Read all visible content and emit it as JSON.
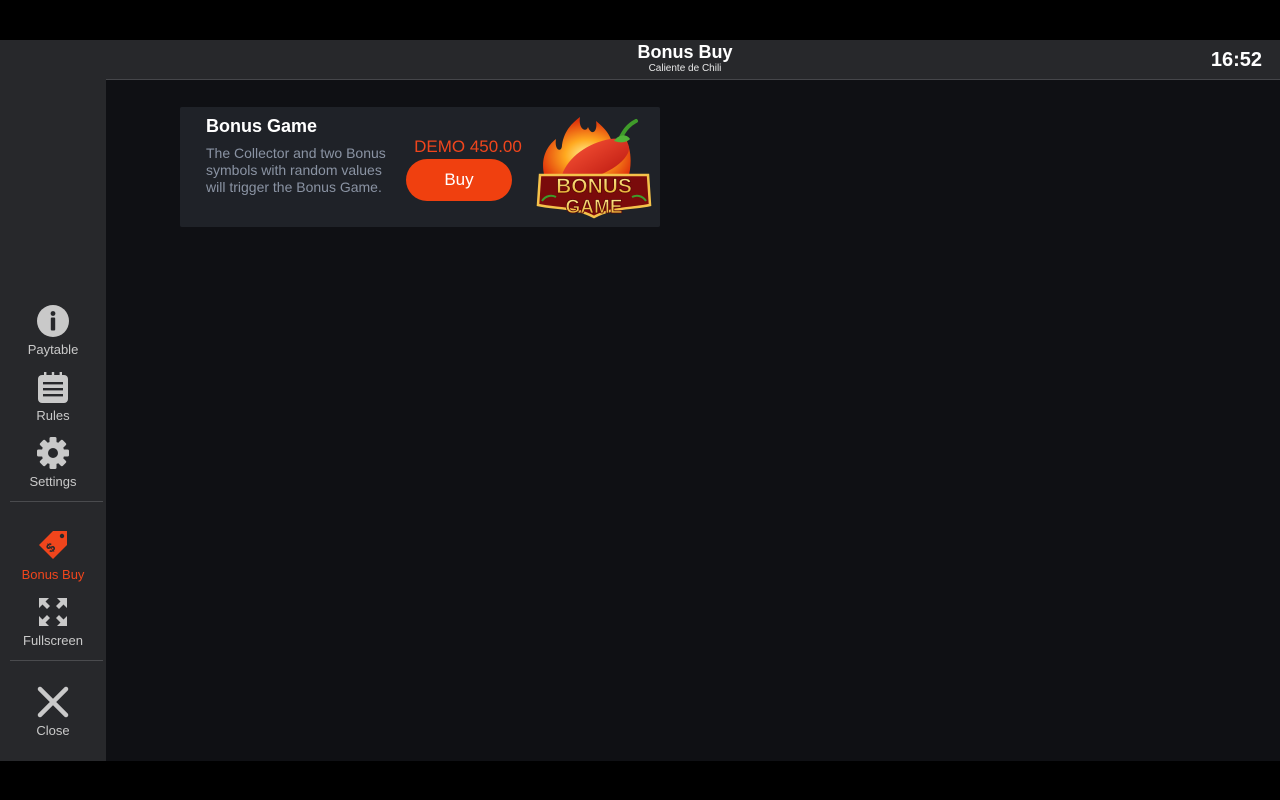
{
  "header": {
    "title": "Bonus Buy",
    "subtitle": "Caliente de Chili",
    "clock": "16:52"
  },
  "sidebar": {
    "items": [
      {
        "label": "Paytable",
        "icon": "info-icon"
      },
      {
        "label": "Rules",
        "icon": "rules-list-icon"
      },
      {
        "label": "Settings",
        "icon": "gear-icon"
      },
      {
        "label": "Bonus Buy",
        "icon": "price-tag-icon",
        "active": true
      },
      {
        "label": "Fullscreen",
        "icon": "fullscreen-icon"
      },
      {
        "label": "Close",
        "icon": "close-icon"
      }
    ]
  },
  "card": {
    "title": "Bonus Game",
    "description": "The Collector and two Bonus symbols with random values will trigger the Bonus Game.",
    "price": "DEMO 450.00",
    "buy_label": "Buy",
    "art_text_line1": "BONUS",
    "art_text_line2": "GAME"
  },
  "colors": {
    "accent": "#f0451c",
    "sidebar_bg": "#27282b",
    "main_bg": "#0f1014",
    "card_bg": "#1f2228"
  }
}
